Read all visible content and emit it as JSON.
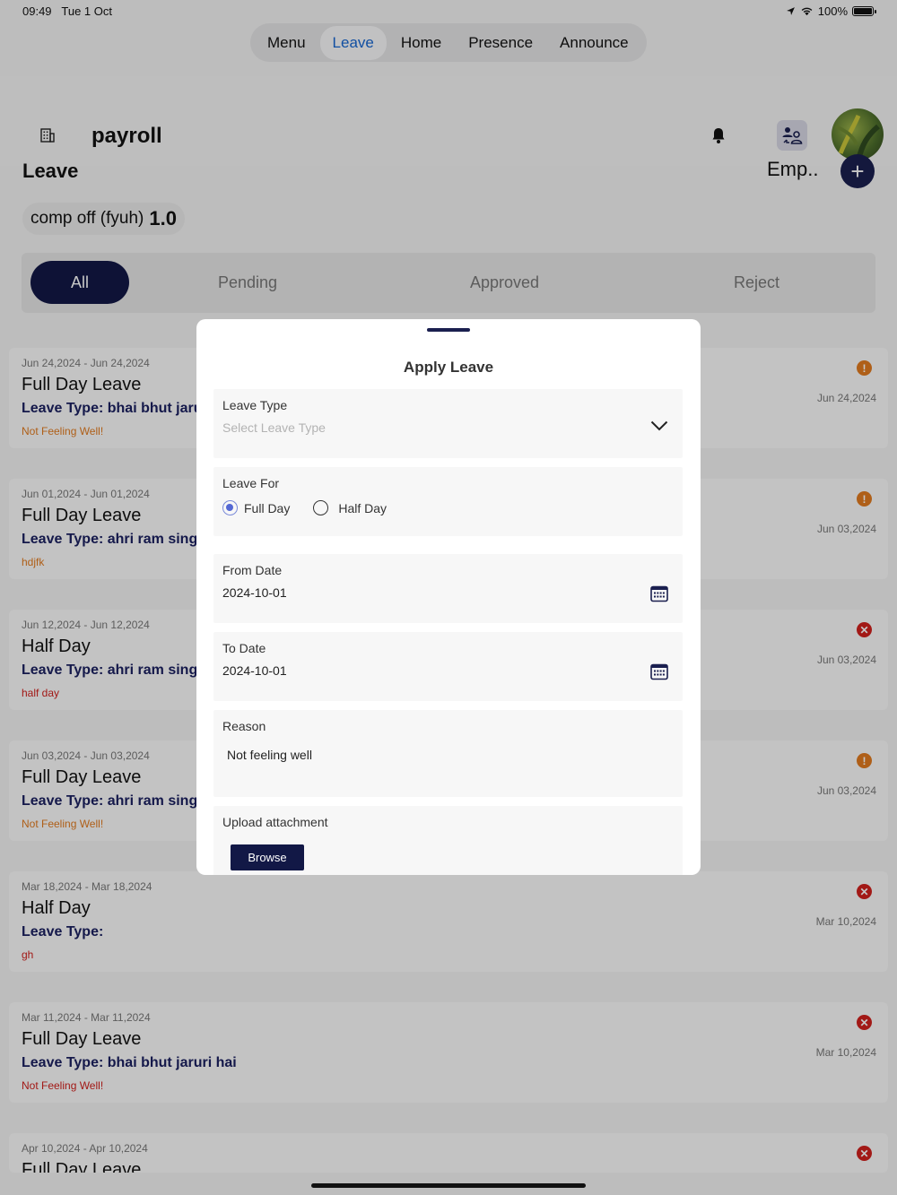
{
  "status_bar": {
    "time": "09:49",
    "date": "Tue 1 Oct",
    "battery": "100%"
  },
  "tabs": [
    {
      "label": "Menu",
      "active": false
    },
    {
      "label": "Leave",
      "active": true
    },
    {
      "label": "Home",
      "active": false
    },
    {
      "label": "Presence",
      "active": false
    },
    {
      "label": "Announce",
      "active": false
    }
  ],
  "header": {
    "brand": "payroll",
    "employee_label": "Emp..",
    "add_label": "+"
  },
  "page_title": "Leave",
  "balance": {
    "label": "comp off (fyuh)",
    "value": "1.0"
  },
  "filters": [
    "All",
    "Pending",
    "Approved",
    "Reject"
  ],
  "leave_cards": [
    {
      "dates": "Jun 24,2024 - Jun 24,2024",
      "title": "Full Day Leave",
      "type": "Leave Type: bhai bhut jaruri hai",
      "reason": "Not Feeling Well!",
      "applied": "Jun 24,2024",
      "status": "pending"
    },
    {
      "dates": "Jun 01,2024 - Jun 01,2024",
      "title": "Full Day Leave",
      "type": "Leave Type: ahri ram singh",
      "reason": "hdjfk",
      "applied": "Jun 03,2024",
      "status": "pending"
    },
    {
      "dates": "Jun 12,2024 - Jun 12,2024",
      "title": "Half Day",
      "type": "Leave Type: ahri ram singh",
      "reason": "half day",
      "applied": "Jun 03,2024",
      "status": "rejected"
    },
    {
      "dates": "Jun 03,2024 - Jun 03,2024",
      "title": "Full Day Leave",
      "type": "Leave Type: ahri ram singh",
      "reason": "Not Feeling Well!",
      "applied": "Jun 03,2024",
      "status": "pending"
    },
    {
      "dates": "Mar 18,2024 - Mar 18,2024",
      "title": "Half Day",
      "type": "Leave Type:",
      "reason": "gh",
      "applied": "Mar 10,2024",
      "status": "rejected"
    },
    {
      "dates": "Mar 11,2024 - Mar 11,2024",
      "title": "Full Day Leave",
      "type": "Leave Type: bhai bhut jaruri hai",
      "reason": "Not Feeling Well!",
      "applied": "Mar 10,2024",
      "status": "rejected"
    },
    {
      "dates": "Apr 10,2024 - Apr 10,2024",
      "title": "Full Day Leave",
      "type": "",
      "reason": "",
      "applied": "",
      "status": "rejected"
    }
  ],
  "modal": {
    "title": "Apply Leave",
    "leave_type": {
      "label": "Leave Type",
      "placeholder": "Select Leave Type"
    },
    "leave_for": {
      "label": "Leave For",
      "options": [
        "Full Day",
        "Half Day"
      ],
      "selected": "Full Day"
    },
    "from_date": {
      "label": "From Date",
      "value": "2024-10-01"
    },
    "to_date": {
      "label": "To Date",
      "value": "2024-10-01"
    },
    "reason": {
      "label": "Reason",
      "value": "Not feeling well"
    },
    "attachment": {
      "label": "Upload attachment",
      "button": "Browse"
    }
  },
  "colors": {
    "primary": "#121846",
    "active_tab_text": "#1666d0",
    "pending": "#e07a1f",
    "rejected": "#d0201d",
    "reason_orange": "#e07a1f",
    "reason_red": "#d0201d"
  }
}
